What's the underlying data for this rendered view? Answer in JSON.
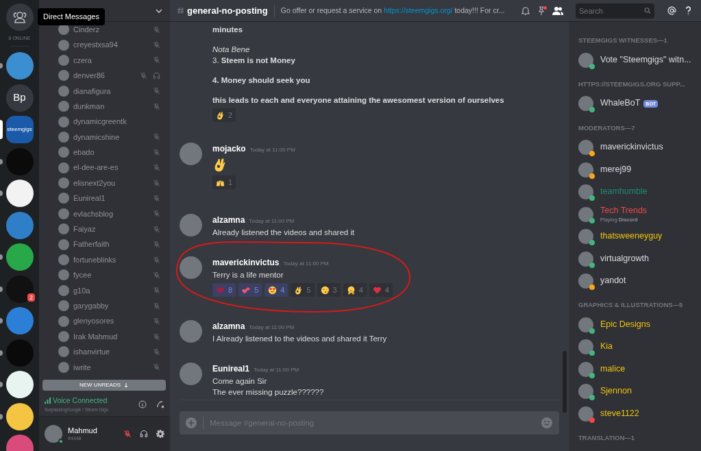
{
  "tooltip": "Direct Messages",
  "online_count": "6 ONLINE",
  "servers": [
    {
      "kind": "image",
      "color": "#3b8fd0",
      "selected": false,
      "unread": true
    },
    {
      "kind": "text",
      "label": "Bp",
      "color": "#36393f",
      "selected": false,
      "unread": false
    },
    {
      "kind": "text",
      "label": "steemgigs",
      "color": "#1a5aa8",
      "selected": true
    },
    {
      "kind": "image",
      "color": "#0b0b0b",
      "selected": false,
      "unread": true
    },
    {
      "kind": "image",
      "color": "#f2f2f2",
      "selected": false,
      "unread": true
    },
    {
      "kind": "image",
      "color": "#2f7fc8",
      "selected": false,
      "unread": false
    },
    {
      "kind": "image",
      "color": "#29a84a",
      "selected": false,
      "unread": true
    },
    {
      "kind": "image",
      "color": "#111111",
      "selected": false,
      "unread": true,
      "badge": "2"
    },
    {
      "kind": "image",
      "color": "#2c7fd6",
      "selected": false,
      "unread": true
    },
    {
      "kind": "image",
      "color": "#0a0a0a",
      "selected": false,
      "unread": true
    },
    {
      "kind": "image",
      "color": "#e8f4f0",
      "selected": false,
      "unread": true
    },
    {
      "kind": "image",
      "color": "#f4c542",
      "selected": false,
      "unread": true
    },
    {
      "kind": "image",
      "color": "#d94b7b",
      "selected": false,
      "unread": false
    }
  ],
  "voice_members": [
    {
      "name": "Cinderz",
      "muted": true,
      "deafened": false
    },
    {
      "name": "creyestxsa94",
      "muted": true,
      "deafened": false
    },
    {
      "name": "czera",
      "muted": true,
      "deafened": false
    },
    {
      "name": "denver86",
      "muted": true,
      "deafened": true
    },
    {
      "name": "dianafigura",
      "muted": true,
      "deafened": false
    },
    {
      "name": "dunkman",
      "muted": true,
      "deafened": false
    },
    {
      "name": "dynamicgreentk",
      "muted": false,
      "deafened": false
    },
    {
      "name": "dynamicshine",
      "muted": true,
      "deafened": false
    },
    {
      "name": "ebado",
      "muted": true,
      "deafened": false
    },
    {
      "name": "el-dee-are-es",
      "muted": true,
      "deafened": false
    },
    {
      "name": "elisnext2you",
      "muted": true,
      "deafened": false
    },
    {
      "name": "Eunireal1",
      "muted": true,
      "deafened": false
    },
    {
      "name": "evlachsblog",
      "muted": true,
      "deafened": false
    },
    {
      "name": "Faiyaz",
      "muted": true,
      "deafened": false
    },
    {
      "name": "Fatherfaith",
      "muted": true,
      "deafened": false
    },
    {
      "name": "fortuneblinks",
      "muted": true,
      "deafened": false
    },
    {
      "name": "fycee",
      "muted": true,
      "deafened": false
    },
    {
      "name": "g10a",
      "muted": true,
      "deafened": false
    },
    {
      "name": "garygabby",
      "muted": true,
      "deafened": false
    },
    {
      "name": "glenyosores",
      "muted": true,
      "deafened": false
    },
    {
      "name": "Irak Mahmud",
      "muted": true,
      "deafened": false
    },
    {
      "name": "ishanvirtue",
      "muted": true,
      "deafened": false
    },
    {
      "name": "iwrite",
      "muted": true,
      "deafened": false
    }
  ],
  "new_unreads": "NEW UNREADS",
  "voice_panel": {
    "status": "Voice Connected",
    "location": "SurpassingGoogle / Steem Gigs"
  },
  "user_panel": {
    "name": "Mahmud",
    "tag": "#4448",
    "muted": true
  },
  "header": {
    "channel": "general-no-posting",
    "topic_before": "Go offer or request a service on ",
    "topic_link": "https://steemgigs.org/",
    "topic_after": " today!!! For cr...",
    "pin_alert": true,
    "search_placeholder": "Search"
  },
  "messages": [
    {
      "circled": false,
      "content": [
        {
          "kind": "bold",
          "text": "minutes"
        },
        {
          "kind": "gap"
        },
        {
          "kind": "italic",
          "text": "Nota Bene"
        },
        {
          "kind": "plain",
          "text": "3. **Steem is not Money**"
        },
        {
          "kind": "gap"
        },
        {
          "kind": "bold",
          "text": "4. Money should seek you"
        },
        {
          "kind": "gap"
        },
        {
          "kind": "bold",
          "text": "this leads to each and everyone attaining the awesomest version of ourselves"
        }
      ],
      "reactions": [
        {
          "kind": "ok-hand",
          "count": "2",
          "selected": false
        }
      ]
    },
    {
      "author": "mojacko",
      "time": "Today at 11:00 PM",
      "circled": false,
      "content": [
        {
          "kind": "ok-hand"
        }
      ],
      "reactions": [
        {
          "kind": "raised-hands",
          "count": "1",
          "selected": false
        }
      ]
    },
    {
      "author": "alzamna",
      "time": "Today at 11:00 PM",
      "circled": false,
      "content": [
        {
          "kind": "plain",
          "text": "Already listened the videos and shared it"
        }
      ]
    },
    {
      "author": "maverickinvictus",
      "time": "Today at 11:00 PM",
      "circled": true,
      "content": [
        {
          "kind": "plain",
          "text": "Terry is a life mentor"
        }
      ],
      "reactions": [
        {
          "kind": "heart-dark",
          "count": "8",
          "selected": true
        },
        {
          "kind": "two-hearts",
          "count": "5",
          "selected": true
        },
        {
          "kind": "heart-eyes",
          "count": "4",
          "selected": true
        },
        {
          "kind": "ok-hand",
          "count": "5",
          "selected": false
        },
        {
          "kind": "kiss",
          "count": "3",
          "selected": false
        },
        {
          "kind": "hug",
          "count": "4",
          "selected": false
        },
        {
          "kind": "heart",
          "count": "4",
          "selected": false
        }
      ]
    },
    {
      "author": "alzamna",
      "time": "Today at 11:00 PM",
      "circled": false,
      "content": [
        {
          "kind": "plain",
          "text": "I Already listened to the videos and shared it Terry"
        }
      ]
    },
    {
      "author": "Eunireal1",
      "time": "Today at 11:00 PM",
      "circled": false,
      "content": [
        {
          "kind": "plain",
          "text": "Come again Sir"
        },
        {
          "kind": "plain",
          "text": "The ever missing puzzle??????"
        }
      ]
    }
  ],
  "composer": {
    "placeholder": "Message #general-no-posting"
  },
  "member_groups": [
    {
      "title": "STEEMGIGS WITNESSES—1",
      "members": [
        {
          "name": "Vote \"Steemgigs\" witn...",
          "color": "#dcddde",
          "kind": "online"
        }
      ]
    },
    {
      "title": "HTTPS://STEEMGIGS.ORG SUPP...",
      "members": [
        {
          "name": "WhaleBoT",
          "color": "#dcddde",
          "kind": "online",
          "badge": "BOT"
        }
      ]
    },
    {
      "title": "MODERATORS—7",
      "members": [
        {
          "name": "maverickinvictus",
          "color": "#dcddde",
          "kind": "idle"
        },
        {
          "name": "merej99",
          "color": "#dcddde",
          "kind": "idle"
        },
        {
          "name": "teamhumble",
          "color": "#1f8b76",
          "kind": "online"
        },
        {
          "name": "Tech Trends",
          "color": "#e84b4b",
          "kind": "online",
          "activity": "Playing **Discord**"
        },
        {
          "name": "thatsweeneyguy",
          "color": "#f1c40f",
          "kind": "online"
        },
        {
          "name": "virtualgrowth",
          "color": "#dcddde",
          "kind": "online"
        },
        {
          "name": "yandot",
          "color": "#dcddde",
          "kind": "idle"
        }
      ]
    },
    {
      "title": "GRAPHICS & ILLUSTRATIONS—5",
      "members": [
        {
          "name": "Epic Designs",
          "color": "#f1c40f",
          "kind": "online"
        },
        {
          "name": "Kia",
          "color": "#f1c40f",
          "kind": "online"
        },
        {
          "name": "malice",
          "color": "#f1c40f",
          "kind": "online"
        },
        {
          "name": "Sjennon",
          "color": "#f1c40f",
          "kind": "online"
        },
        {
          "name": "steve1122",
          "color": "#f1c40f",
          "kind": "dnd"
        }
      ]
    },
    {
      "title": "TRANSLATION—1"
    }
  ]
}
